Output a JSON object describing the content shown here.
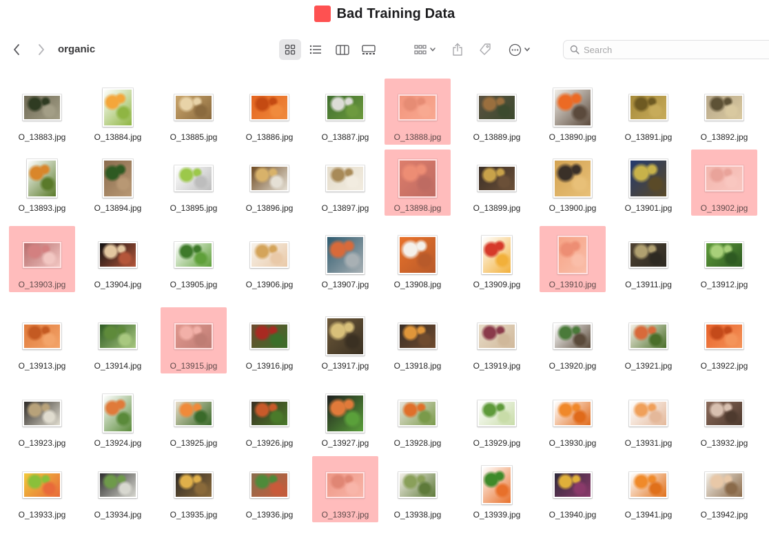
{
  "window": {
    "title": "Bad Training Data",
    "title_tag_color": "#fe5151"
  },
  "toolbar": {
    "folder": "organic",
    "back_icon": "chevron-left-icon",
    "forward_icon": "chevron-right-icon",
    "views": [
      "icon-view",
      "list-view",
      "column-view",
      "gallery-view"
    ],
    "active_view": "icon-view",
    "search_placeholder": "Search"
  },
  "highlight_color": "#ffbcbc",
  "files": [
    {
      "name": "O_13883.jpg",
      "flagged": false,
      "colors": [
        "#6f6a55",
        "#2f3b22",
        "#a39e86"
      ],
      "ratio": "wide"
    },
    {
      "name": "O_13884.jpg",
      "flagged": false,
      "colors": [
        "#ffffff",
        "#f4a63a",
        "#8fb543"
      ],
      "ratio": "tall"
    },
    {
      "name": "O_13885.jpg",
      "flagged": false,
      "colors": [
        "#c9a46a",
        "#e8d3a8",
        "#8a6a3e"
      ],
      "ratio": "wide"
    },
    {
      "name": "O_13886.jpg",
      "flagged": false,
      "colors": [
        "#e3641f",
        "#c44a12",
        "#f08a3c"
      ],
      "ratio": "wide"
    },
    {
      "name": "O_13887.jpg",
      "flagged": false,
      "colors": [
        "#3f6e2e",
        "#dcdcd6",
        "#6d9a3e"
      ],
      "ratio": "wide"
    },
    {
      "name": "O_13888.jpg",
      "flagged": true,
      "colors": [
        "#e8754a",
        "#d3653a",
        "#f49a6e"
      ],
      "ratio": "wide"
    },
    {
      "name": "O_13889.jpg",
      "flagged": false,
      "colors": [
        "#5b5140",
        "#9a6f3e",
        "#3c4a2e"
      ],
      "ratio": "wide"
    },
    {
      "name": "O_13890.jpg",
      "flagged": false,
      "colors": [
        "#f1eee8",
        "#ec6a24",
        "#5b4a3c"
      ],
      "ratio": "square"
    },
    {
      "name": "O_13891.jpg",
      "flagged": false,
      "colors": [
        "#a68a3a",
        "#6e5a22",
        "#c7ab5a"
      ],
      "ratio": "wide"
    },
    {
      "name": "O_13892.jpg",
      "flagged": false,
      "colors": [
        "#b8a88a",
        "#5e5236",
        "#d9c9a0"
      ],
      "ratio": "wide"
    },
    {
      "name": "O_13893.jpg",
      "flagged": false,
      "colors": [
        "#ffffff",
        "#d9862a",
        "#5a7a2a"
      ],
      "ratio": "tall"
    },
    {
      "name": "O_13894.jpg",
      "flagged": false,
      "colors": [
        "#8a6c4e",
        "#2e5a22",
        "#b89874"
      ],
      "ratio": "tall"
    },
    {
      "name": "O_13895.jpg",
      "flagged": false,
      "colors": [
        "#ffffff",
        "#9cc84a",
        "#bdbdbd"
      ],
      "ratio": "wide"
    },
    {
      "name": "O_13896.jpg",
      "flagged": false,
      "colors": [
        "#6e4a22",
        "#d8b26a",
        "#e5e0d5"
      ],
      "ratio": "wide"
    },
    {
      "name": "O_13897.jpg",
      "flagged": false,
      "colors": [
        "#e4dccb",
        "#a88a58",
        "#f2ece0"
      ],
      "ratio": "wide"
    },
    {
      "name": "O_13898.jpg",
      "flagged": true,
      "colors": [
        "#c24b2a",
        "#e0673a",
        "#8a2a1a"
      ],
      "ratio": "square"
    },
    {
      "name": "O_13899.jpg",
      "flagged": false,
      "colors": [
        "#3a2e26",
        "#c8a24a",
        "#6b5038"
      ],
      "ratio": "wide"
    },
    {
      "name": "O_13900.jpg",
      "flagged": false,
      "colors": [
        "#d3a352",
        "#3a3028",
        "#e8c078"
      ],
      "ratio": "square"
    },
    {
      "name": "O_13901.jpg",
      "flagged": false,
      "colors": [
        "#243a6e",
        "#c8b24a",
        "#5a4a28"
      ],
      "ratio": "square"
    },
    {
      "name": "O_13902.jpg",
      "flagged": true,
      "colors": [
        "#e9b3a4",
        "#d89080",
        "#f5d0c4"
      ],
      "ratio": "wide"
    },
    {
      "name": "O_13903.jpg",
      "flagged": true,
      "colors": [
        "#7a2a2a",
        "#b05050",
        "#e8d0c8"
      ],
      "ratio": "wide"
    },
    {
      "name": "O_13904.jpg",
      "flagged": false,
      "colors": [
        "#111111",
        "#e3c7a0",
        "#b4563a"
      ],
      "ratio": "wide"
    },
    {
      "name": "O_13905.jpg",
      "flagged": false,
      "colors": [
        "#ffffff",
        "#3e7a2a",
        "#5fa03a"
      ],
      "ratio": "wide"
    },
    {
      "name": "O_13906.jpg",
      "flagged": false,
      "colors": [
        "#f7f2ea",
        "#d4a45a",
        "#e9c9a8"
      ],
      "ratio": "wide"
    },
    {
      "name": "O_13907.jpg",
      "flagged": false,
      "colors": [
        "#2e5a6e",
        "#d86a3a",
        "#a8b0b4"
      ],
      "ratio": "square"
    },
    {
      "name": "O_13908.jpg",
      "flagged": false,
      "colors": [
        "#e9722a",
        "#f4f0ea",
        "#b85a2a"
      ],
      "ratio": "square"
    },
    {
      "name": "O_13909.jpg",
      "flagged": false,
      "colors": [
        "#ffffff",
        "#d63a2a",
        "#f2b03a"
      ],
      "ratio": "tall"
    },
    {
      "name": "O_13910.jpg",
      "flagged": true,
      "colors": [
        "#f0905a",
        "#e06a3a",
        "#f6c09a"
      ],
      "ratio": "tall"
    },
    {
      "name": "O_13911.jpg",
      "flagged": false,
      "colors": [
        "#4e4232",
        "#b0a070",
        "#2e2a22"
      ],
      "ratio": "wide"
    },
    {
      "name": "O_13912.jpg",
      "flagged": false,
      "colors": [
        "#5e9a3a",
        "#a8d07a",
        "#2e5a22"
      ],
      "ratio": "wide"
    },
    {
      "name": "O_13913.jpg",
      "flagged": false,
      "colors": [
        "#e07a3a",
        "#c45a22",
        "#f3a46a"
      ],
      "ratio": "wide"
    },
    {
      "name": "O_13914.jpg",
      "flagged": false,
      "colors": [
        "#2e5a22",
        "#5e8a3a",
        "#a8c880"
      ],
      "ratio": "wide"
    },
    {
      "name": "O_13915.jpg",
      "flagged": true,
      "colors": [
        "#c87a6a",
        "#e8a898",
        "#8a4a3a"
      ],
      "ratio": "wide"
    },
    {
      "name": "O_13916.jpg",
      "flagged": false,
      "colors": [
        "#6e4a2e",
        "#a82a22",
        "#3a6e2a"
      ],
      "ratio": "wide"
    },
    {
      "name": "O_13917.jpg",
      "flagged": false,
      "colors": [
        "#6e5a3a",
        "#d8c07a",
        "#3a3022"
      ],
      "ratio": "square"
    },
    {
      "name": "O_13918.jpg",
      "flagged": false,
      "colors": [
        "#3a2e26",
        "#e0963a",
        "#6e4a2e"
      ],
      "ratio": "wide"
    },
    {
      "name": "O_13919.jpg",
      "flagged": false,
      "colors": [
        "#e8dcc8",
        "#8a3a4a",
        "#d0b89a"
      ],
      "ratio": "wide"
    },
    {
      "name": "O_13920.jpg",
      "flagged": false,
      "colors": [
        "#ffffff",
        "#4a7a3a",
        "#5a4a3a"
      ],
      "ratio": "wide"
    },
    {
      "name": "O_13921.jpg",
      "flagged": false,
      "colors": [
        "#f6f0e6",
        "#d86a3a",
        "#4a6e2a"
      ],
      "ratio": "wide"
    },
    {
      "name": "O_13922.jpg",
      "flagged": false,
      "colors": [
        "#e8622a",
        "#c44a1a",
        "#f4945a"
      ],
      "ratio": "wide"
    },
    {
      "name": "O_13923.jpg",
      "flagged": false,
      "colors": [
        "#2e2a26",
        "#b8a27a",
        "#e0dccf"
      ],
      "ratio": "wide"
    },
    {
      "name": "O_13924.jpg",
      "flagged": false,
      "colors": [
        "#ffffff",
        "#e07a3a",
        "#5a8a3a"
      ],
      "ratio": "tall"
    },
    {
      "name": "O_13925.jpg",
      "flagged": false,
      "colors": [
        "#e8dcc8",
        "#f08a3a",
        "#3a6a2a"
      ],
      "ratio": "wide"
    },
    {
      "name": "O_13926.jpg",
      "flagged": false,
      "colors": [
        "#3a2e22",
        "#c85a2a",
        "#4a7a2a"
      ],
      "ratio": "wide"
    },
    {
      "name": "O_13927.jpg",
      "flagged": false,
      "colors": [
        "#1e1e1e",
        "#e07a3a",
        "#5aa03a"
      ],
      "ratio": "square"
    },
    {
      "name": "O_13928.jpg",
      "flagged": false,
      "colors": [
        "#e8e4dc",
        "#e0702a",
        "#7a9a4a"
      ],
      "ratio": "wide"
    },
    {
      "name": "O_13929.jpg",
      "flagged": false,
      "colors": [
        "#ffffff",
        "#5e9a3a",
        "#c8dca8"
      ],
      "ratio": "wide"
    },
    {
      "name": "O_13930.jpg",
      "flagged": false,
      "colors": [
        "#ffffff",
        "#f0882a",
        "#e06a1a"
      ],
      "ratio": "wide"
    },
    {
      "name": "O_13931.jpg",
      "flagged": false,
      "colors": [
        "#ffffff",
        "#f0a05a",
        "#e4b89a"
      ],
      "ratio": "wide"
    },
    {
      "name": "O_13932.jpg",
      "flagged": false,
      "colors": [
        "#8a6a5a",
        "#d8c0b0",
        "#4e3a2e"
      ],
      "ratio": "wide"
    },
    {
      "name": "O_13933.jpg",
      "flagged": false,
      "colors": [
        "#f0c83a",
        "#8ac03a",
        "#e86a3a"
      ],
      "ratio": "wide"
    },
    {
      "name": "O_13934.jpg",
      "flagged": false,
      "colors": [
        "#2e2e2e",
        "#6e9a4a",
        "#d8d8d0"
      ],
      "ratio": "wide"
    },
    {
      "name": "O_13935.jpg",
      "flagged": false,
      "colors": [
        "#2e2a26",
        "#e0b04a",
        "#8a6a3a"
      ],
      "ratio": "wide"
    },
    {
      "name": "O_13936.jpg",
      "flagged": false,
      "colors": [
        "#8a6e4e",
        "#4e8a3a",
        "#c85a3a"
      ],
      "ratio": "wide"
    },
    {
      "name": "O_13937.jpg",
      "flagged": true,
      "colors": [
        "#e07a5a",
        "#c85a3a",
        "#f4b09a"
      ],
      "ratio": "wide"
    },
    {
      "name": "O_13938.jpg",
      "flagged": false,
      "colors": [
        "#f4f0e8",
        "#8aa05a",
        "#5e7a3a"
      ],
      "ratio": "wide"
    },
    {
      "name": "O_13939.jpg",
      "flagged": false,
      "colors": [
        "#ffffff",
        "#3e8a2a",
        "#e8702a"
      ],
      "ratio": "tall"
    },
    {
      "name": "O_13940.jpg",
      "flagged": false,
      "colors": [
        "#2e2a3a",
        "#e0b03a",
        "#8a3a6a"
      ],
      "ratio": "wide"
    },
    {
      "name": "O_13941.jpg",
      "flagged": false,
      "colors": [
        "#ffffff",
        "#f08a2a",
        "#e0701a"
      ],
      "ratio": "wide"
    },
    {
      "name": "O_13942.jpg",
      "flagged": false,
      "colors": [
        "#f4f0e8",
        "#e8c8a8",
        "#8a6a4a"
      ],
      "ratio": "wide"
    }
  ]
}
